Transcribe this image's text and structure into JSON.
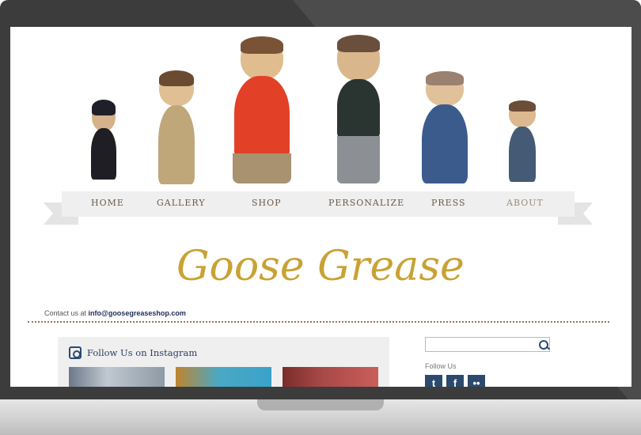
{
  "nav": {
    "items": [
      {
        "label": "HOME"
      },
      {
        "label": "GALLERY"
      },
      {
        "label": "SHOP"
      },
      {
        "label": "PERSONALIZE"
      },
      {
        "label": "PRESS"
      },
      {
        "label": "ABOUT"
      }
    ]
  },
  "logo": {
    "text": "Goose Grease"
  },
  "contact": {
    "prefix": "Contact us at",
    "email": "info@goosegreaseshop.com"
  },
  "instagram": {
    "title": "Follow Us on Instagram"
  },
  "sidebar": {
    "follow_label": "Follow Us"
  },
  "social": [
    "twitter-icon",
    "facebook-icon",
    "flickr-icon"
  ],
  "colors": {
    "logo_gold": "#c9a234",
    "accent_blue": "#2c4a6e"
  }
}
